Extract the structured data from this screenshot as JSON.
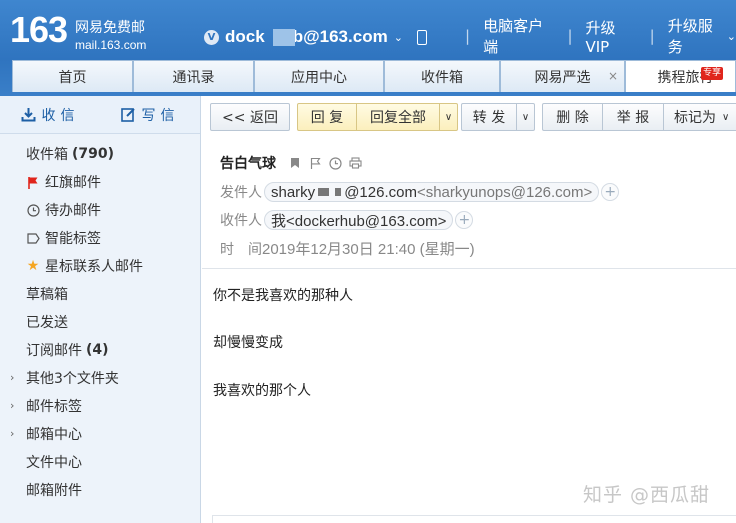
{
  "brand": {
    "number": "163",
    "name_cn": "网易免费邮",
    "url": "mail.163.com"
  },
  "account": {
    "badge": "V",
    "email_prefix": "dock",
    "email_suffix": "b@163.com"
  },
  "top_links": [
    "电脑客户端",
    "升级VIP",
    "升级服务"
  ],
  "tabs": [
    {
      "label": "首页"
    },
    {
      "label": "通讯录"
    },
    {
      "label": "应用中心"
    },
    {
      "label": "收件箱"
    },
    {
      "label": "网易严选"
    },
    {
      "label": "携程旅行",
      "badge": "专享"
    }
  ],
  "sidebar": {
    "receive_label": "收信",
    "compose_label": "写信",
    "folders": [
      {
        "label": "收件箱",
        "count": "(790)"
      },
      {
        "label": "红旗邮件",
        "icon": "red-flag-icon"
      },
      {
        "label": "待办邮件",
        "icon": "clock-icon"
      },
      {
        "label": "智能标签",
        "icon": "tag-icon"
      },
      {
        "label": "星标联系人邮件",
        "icon": "star-icon"
      },
      {
        "label": "草稿箱"
      },
      {
        "label": "已发送"
      },
      {
        "label": "订阅邮件",
        "count": "(4)"
      },
      {
        "label": "其他3个文件夹",
        "expandable": true
      },
      {
        "label": "邮件标签",
        "expandable": true
      },
      {
        "label": "邮箱中心",
        "expandable": true
      },
      {
        "label": "文件中心"
      },
      {
        "label": "邮箱附件"
      }
    ]
  },
  "toolbar": {
    "back": "<< 返回",
    "reply": "回 复",
    "reply_all": "回复全部",
    "forward": "转 发",
    "delete": "删 除",
    "report": "举 报",
    "mark_as": "标记为"
  },
  "message": {
    "subject": "告白气球",
    "from_label": "发件人",
    "from_name_start": "sharky",
    "from_addr_end": "@126.com",
    "from_email": "<sharkyunops@126.com>",
    "to_label": "收件人",
    "to_value": "我<dockerhub@163.com>",
    "time_label": "时　间",
    "time_value": "2019年12月30日 21:40 (星期一)",
    "body": [
      "你不是我喜欢的那种人",
      "却慢慢变成",
      "我喜欢的那个人"
    ]
  },
  "watermark": "知乎 @西瓜甜",
  "colors": {
    "header_blue": "#2f74bf",
    "sidebar_bg": "#edf3fa",
    "reply_yellow": "#fbefbd",
    "flag_red": "#e0251c",
    "star_gold": "#f5a623"
  }
}
